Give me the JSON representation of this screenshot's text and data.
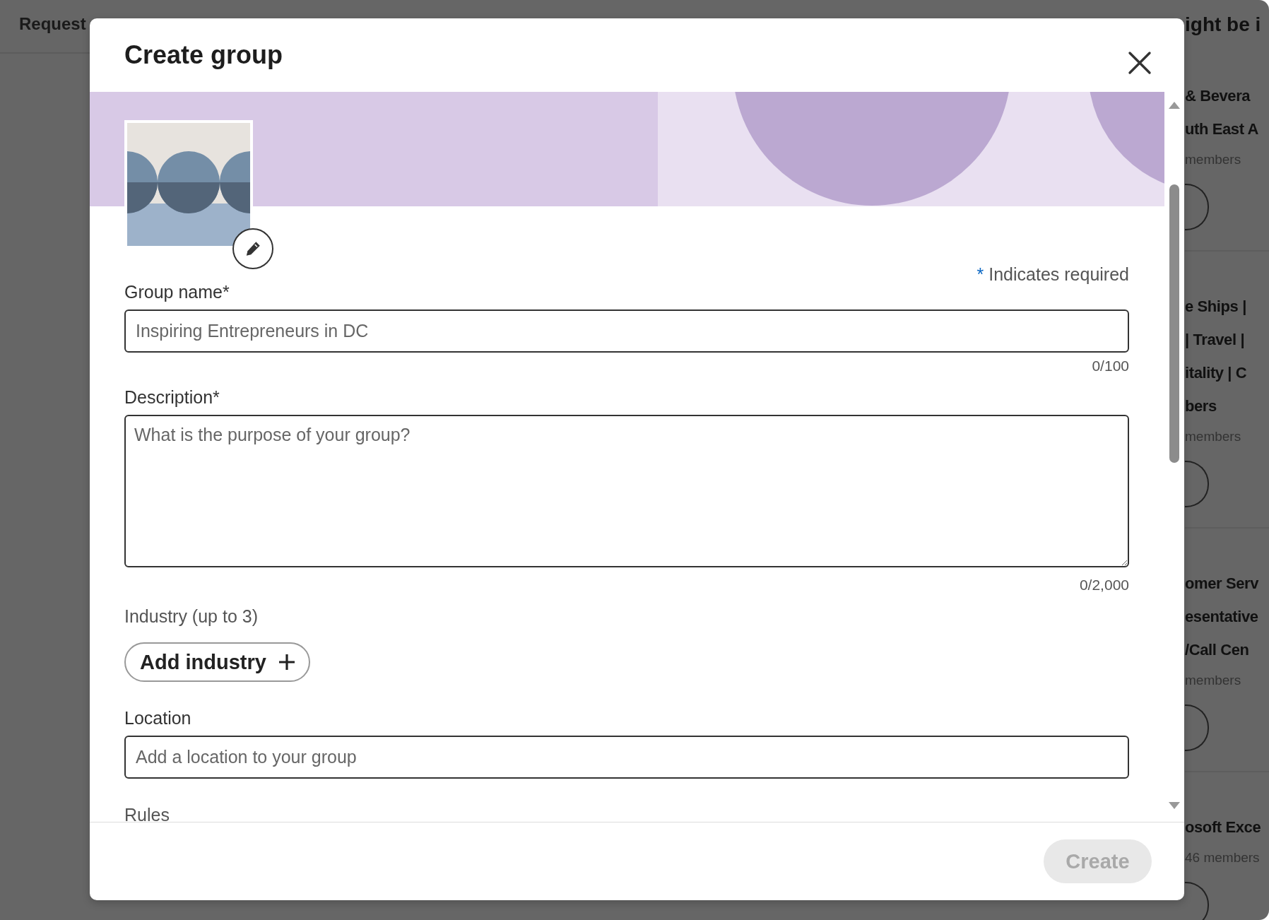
{
  "background": {
    "top_bar": {
      "tab": "Request"
    },
    "sidebar": {
      "heading": "ight be i",
      "groups": [
        {
          "name_lines": [
            "& Bevera",
            "uth East A"
          ],
          "members": "members"
        },
        {
          "name_lines": [
            "e Ships |",
            "| Travel |",
            "itality | C",
            "bers"
          ],
          "members": "members"
        },
        {
          "name_lines": [
            "omer Serv",
            "esentative",
            "/Call Cen"
          ],
          "members": "members"
        },
        {
          "name_lines": [
            "osoft Exce"
          ],
          "members": "46 members"
        }
      ]
    }
  },
  "dialog": {
    "title": "Create group",
    "required_note": {
      "mark": "*",
      "text": "Indicates required"
    },
    "fields": [
      {
        "kind": "input",
        "label": "Group name*",
        "placeholder": "Inspiring Entrepreneurs in DC",
        "counter": "0/100"
      },
      {
        "kind": "textarea",
        "label": "Description*",
        "placeholder": "What is the purpose of your group?",
        "counter": "0/2,000"
      },
      {
        "kind": "add_button",
        "label": "Industry (up to 3)",
        "button": "Add industry"
      },
      {
        "kind": "input",
        "label": "Location",
        "placeholder": "Add a location to your group"
      },
      {
        "kind": "heading",
        "label": "Rules"
      }
    ],
    "create_button": {
      "label": "Create",
      "disabled": true
    }
  }
}
